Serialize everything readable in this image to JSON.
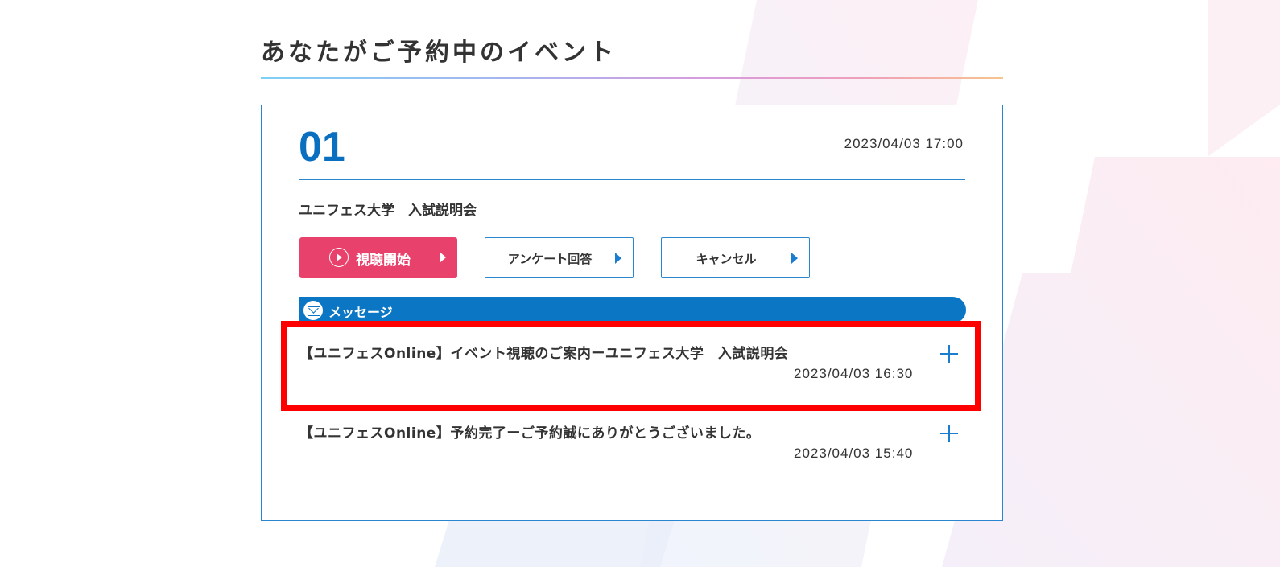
{
  "page": {
    "title": "あなたがご予約中のイベント"
  },
  "event": {
    "number": "01",
    "datetime": "2023/04/03 17:00",
    "name": "ユニフェス大学　入試説明会"
  },
  "buttons": {
    "watch_label": "視聴開始",
    "survey_label": "アンケート回答",
    "cancel_label": "キャンセル"
  },
  "messages": {
    "title": "メッセージ",
    "items": [
      {
        "subject": "【ユニフェスOnline】イベント視聴のご案内ーユニフェス大学　入試説明会",
        "date": "2023/04/03 16:30"
      },
      {
        "subject": "【ユニフェスOnline】予約完了ーご予約誠にありがとうございました。",
        "date": "2023/04/03 15:40"
      }
    ]
  },
  "colors": {
    "accent_blue": "#0a76c4",
    "watch_button": "#e8416b",
    "highlight": "#ff0000"
  },
  "icons": {
    "watch_button": "play-circle-icon",
    "message_header": "mail-icon",
    "expand": "plus-icon",
    "button_arrow": "caret-right-icon"
  }
}
